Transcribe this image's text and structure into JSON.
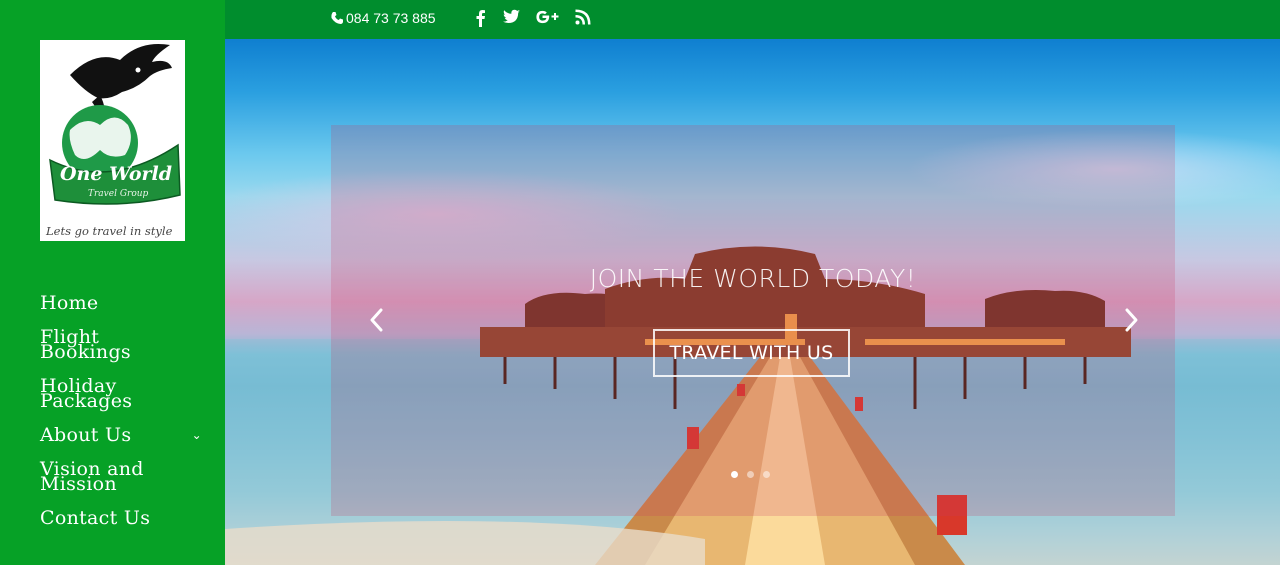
{
  "brand": {
    "logo_text": "One World",
    "logo_subtitle": "Travel Group",
    "logo_tagline": "Lets go travel in style"
  },
  "topbar": {
    "phone": "084 73 73 885",
    "social_icons": [
      "facebook-icon",
      "twitter-icon",
      "google-plus-icon",
      "rss-icon"
    ]
  },
  "nav": {
    "items": [
      {
        "label_lines": [
          "Home"
        ],
        "has_submenu": false
      },
      {
        "label_lines": [
          "Flight",
          "Bookings"
        ],
        "has_submenu": false
      },
      {
        "label_lines": [
          "Holiday",
          "Packages"
        ],
        "has_submenu": false
      },
      {
        "label_lines": [
          "About Us"
        ],
        "has_submenu": true
      },
      {
        "label_lines": [
          "Vision and",
          "Mission"
        ],
        "has_submenu": false
      },
      {
        "label_lines": [
          "Contact Us"
        ],
        "has_submenu": false
      }
    ],
    "submenu_glyph": "⌄"
  },
  "slider": {
    "title": "JOIN THE WORLD TODAY!",
    "button_label": "TRAVEL WITH US",
    "slide_count": 3,
    "active_slide": 1
  },
  "colors": {
    "sidebar": "#06a126",
    "topbar": "#008d2d",
    "logo_green": "#1e8f3a"
  }
}
